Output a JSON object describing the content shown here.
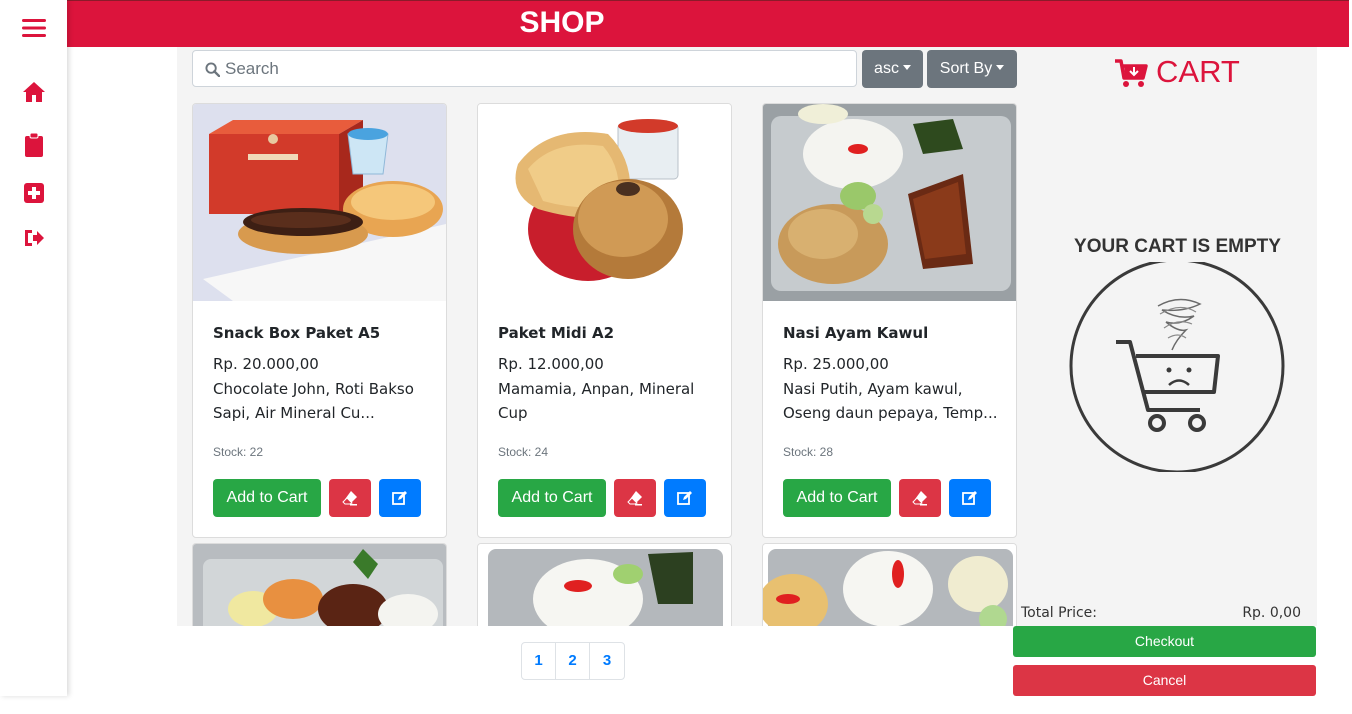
{
  "header": {
    "title": "SHOP"
  },
  "sidebar": {
    "items": [
      {
        "icon": "hamburger-menu-icon"
      },
      {
        "icon": "home-icon"
      },
      {
        "icon": "clipboard-icon"
      },
      {
        "icon": "plus-square-icon"
      },
      {
        "icon": "sign-out-icon"
      }
    ]
  },
  "toolbar": {
    "search_placeholder": "Search",
    "order_label": "asc",
    "sort_label": "Sort By"
  },
  "products": [
    {
      "name": "Snack Box Paket A5",
      "price": "Rp. 20.000,00",
      "description": "Chocolate John, Roti Bakso Sapi, Air Mineral Cu...",
      "stock": "Stock: 22",
      "add_label": "Add to Cart"
    },
    {
      "name": "Paket Midi A2",
      "price": "Rp. 12.000,00",
      "description": "Mamamia, Anpan, Mineral Cup",
      "stock": "Stock: 24",
      "add_label": "Add to Cart"
    },
    {
      "name": "Nasi Ayam Kawul",
      "price": "Rp. 25.000,00",
      "description": "Nasi Putih, Ayam kawul, Oseng daun pepaya, Temp...",
      "stock": "Stock: 28",
      "add_label": "Add to Cart"
    }
  ],
  "pagination": {
    "pages": [
      "1",
      "2",
      "3"
    ]
  },
  "cart": {
    "title": "CART",
    "empty_message": "YOUR CART IS EMPTY",
    "total_label": "Total Price:",
    "total_value": "Rp. 0,00",
    "checkout_label": "Checkout",
    "cancel_label": "Cancel"
  },
  "colors": {
    "brand": "#dc143c",
    "success": "#28a745",
    "danger": "#dc3545",
    "primary": "#007bff",
    "secondary": "#6c757d"
  }
}
